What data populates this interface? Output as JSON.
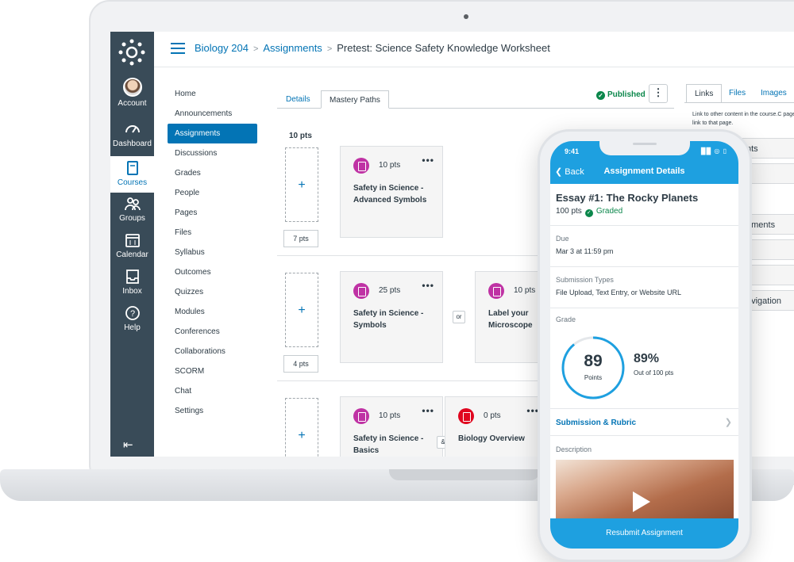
{
  "breadcrumb": {
    "course": "Biology 204",
    "section": "Assignments",
    "current": "Pretest: Science Safety Knowledge Worksheet"
  },
  "global_nav": {
    "account": "Account",
    "dashboard": "Dashboard",
    "courses": "Courses",
    "groups": "Groups",
    "calendar": "Calendar",
    "inbox": "Inbox",
    "help": "Help"
  },
  "course_nav": [
    "Home",
    "Announcements",
    "Assignments",
    "Discussions",
    "Grades",
    "People",
    "Pages",
    "Files",
    "Syllabus",
    "Outcomes",
    "Quizzes",
    "Modules",
    "Conferences",
    "Collaborations",
    "SCORM",
    "Chat",
    "Settings"
  ],
  "course_nav_active": "Assignments",
  "tabs": {
    "details": "Details",
    "mastery": "Mastery Paths"
  },
  "status": {
    "published": "Published"
  },
  "right_panel": {
    "tabs": [
      "Links",
      "Files",
      "Images"
    ],
    "help": "Link to other content in the course.C page to insert a link to that page.",
    "rows": [
      "nts",
      "",
      "ements",
      "s",
      "",
      "avigation"
    ]
  },
  "mastery": {
    "header_pts": "10 pts",
    "rows": [
      {
        "score": "7 pts",
        "cards": [
          {
            "pts": "10 pts",
            "title": "Safety in Science - Advanced Symbols"
          }
        ]
      },
      {
        "score": "4 pts",
        "conj": "or",
        "cards": [
          {
            "pts": "25 pts",
            "title": "Safety in Science - Symbols"
          },
          {
            "pts": "10 pts",
            "title": "Label your Microscope"
          }
        ]
      },
      {
        "conj": "&",
        "cards": [
          {
            "pts": "10 pts",
            "title": "Safety in Science - Basics"
          },
          {
            "pts": "0 pts",
            "title": "Biology Overview"
          }
        ]
      }
    ]
  },
  "phone": {
    "time": "9:41",
    "back": "Back",
    "title": "Assignment Details",
    "assignment": "Essay #1: The Rocky Planets",
    "points": "100 pts",
    "graded": "Graded",
    "due_label": "Due",
    "due_value": "Mar 3 at 11:59 pm",
    "submission_label": "Submission Types",
    "submission_value": "File Upload, Text Entry, or Website URL",
    "grade_label": "Grade",
    "score": "89",
    "score_unit": "Points",
    "score_fraction": 0.89,
    "percent": "89%",
    "out_of": "Out of 100 pts",
    "rubric_link": "Submission & Rubric",
    "description_label": "Description",
    "resubmit": "Resubmit Assignment"
  },
  "colors": {
    "brand": "#0374b5",
    "nav_bg": "#394b58",
    "phone_accent": "#1ea0e0",
    "success": "#0b874b"
  }
}
